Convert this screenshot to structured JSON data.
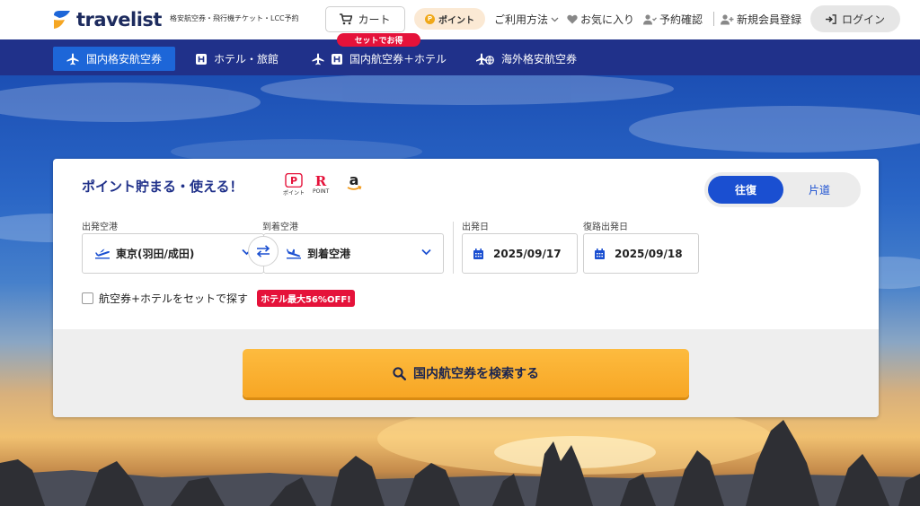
{
  "header": {
    "logo_text": "travelist",
    "tagline": "格安航空券・飛行機チケット・LCC予約",
    "cart_label": "カート",
    "points_label": "ポイント",
    "points_coin": "P",
    "nav": {
      "how_to_use": "ご利用方法",
      "favorites": "お気に入り",
      "bookings": "予約確認",
      "register": "新規会員登録",
      "login": "ログイン"
    }
  },
  "tabs": [
    {
      "label": "国内格安航空券"
    },
    {
      "label": "ホテル・旅館"
    },
    {
      "label": "国内航空券＋ホテル"
    },
    {
      "label": "海外格安航空券"
    }
  ],
  "tab_badge": "セットでお得",
  "search": {
    "promo_title": "ポイント貯まる・使える！",
    "brands": [
      {
        "mark": "P",
        "caption": "ポイント"
      },
      {
        "mark": "R",
        "caption": "POINT"
      },
      {
        "mark": "a",
        "caption": ""
      }
    ],
    "trip_type": {
      "round_trip": "往復",
      "one_way": "片道"
    },
    "departure_airport_label": "出発空港",
    "departure_airport_value": "東京(羽田/成田)",
    "arrival_airport_label": "到着空港",
    "arrival_airport_value": "到着空港",
    "departure_date_label": "出発日",
    "departure_date_value": "2025/09/17",
    "return_date_label": "復路出発日",
    "return_date_value": "2025/09/18",
    "hotel_set_label": "航空券+ホテルをセットで探す",
    "hotel_discount_tag": "ホテル最大56%OFF!",
    "submit_label": "国内航空券を検索する"
  },
  "colors": {
    "navy": "#20318a",
    "accent_blue": "#1a4fd1",
    "cta_orange": "#f7a624",
    "sale_red": "#e5123a"
  }
}
